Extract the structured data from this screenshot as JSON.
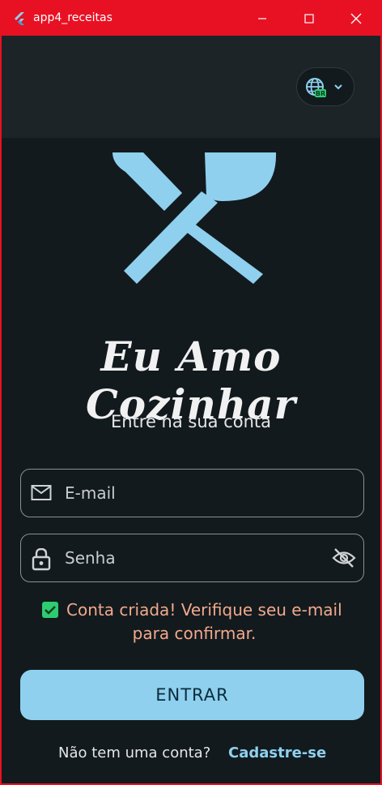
{
  "window": {
    "title": "app4_receitas",
    "accent_color": "#e81123",
    "controls": {
      "minimize": "minimize-icon",
      "maximize": "maximize-icon",
      "close": "close-icon"
    }
  },
  "appbar": {
    "language_button": {
      "icon": "globe-icon",
      "badge": "BR",
      "chevron": "chevron-down-icon"
    }
  },
  "login": {
    "logo_icon": "fork-spoon-crossed-icon",
    "brand_name": "Eu Amo Cozinhar",
    "subtitle": "Entre na sua conta",
    "email": {
      "icon": "mail-icon",
      "placeholder": "E-mail",
      "value": ""
    },
    "password": {
      "icon": "lock-icon",
      "placeholder": "Senha",
      "value": "",
      "visibility_icon": "eye-off-icon"
    },
    "notice": {
      "checked": true,
      "line1": "Conta criada! Verifique seu e-mail",
      "line2": "para confirmar.",
      "color": "#f3a98b"
    },
    "submit_label": "ENTRAR",
    "signup_question": "Não tem uma conta?",
    "signup_link": "Cadastre-se",
    "primary_color": "#8fd0ee"
  }
}
